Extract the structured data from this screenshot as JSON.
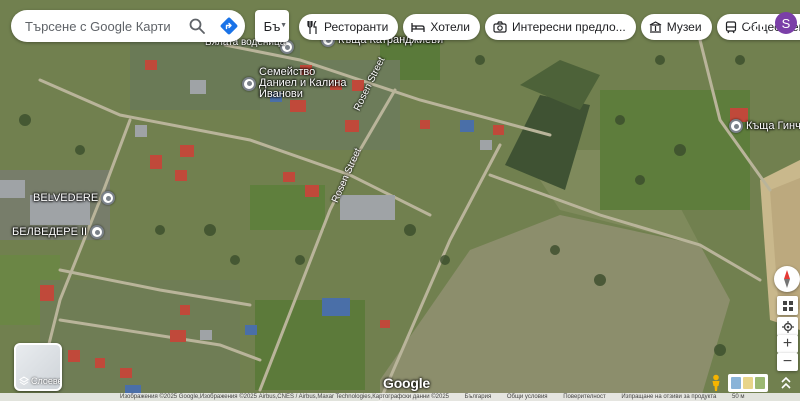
{
  "search": {
    "placeholder": "Търсене с Google Карти"
  },
  "lang_label": "Бъ",
  "chips": [
    "Ресторанти",
    "Хотели",
    "Интересни предло...",
    "Музеи",
    "Обществен"
  ],
  "user_initial": "S",
  "places": [
    {
      "name": "Бялата воденица"
    },
    {
      "name": "Къща Катранджиеви"
    },
    {
      "name": "Семейство Даниел и Калина Иванови"
    },
    {
      "name": "Къща Гинчев"
    },
    {
      "name": "BELVEDERE"
    },
    {
      "name": "БЕЛВЕДЕРЕ II"
    }
  ],
  "streets": [
    "Rosen Street",
    "Rosen Street"
  ],
  "layers_label": "Слоеве",
  "logo": "Google",
  "attribution": [
    "Изображения ©2025 Google,Изображения ©2025 Airbus,CNES / Airbus,Maxar Technologies,Картографски данни ©2025",
    "България",
    "Общи условия",
    "Поверителност",
    "Изпращане на отзиви за продукта",
    "50 м"
  ],
  "colors": {
    "pin_gray": "#7a8189",
    "accent_blue": "#1a73e8",
    "avatar": "#7b3fa8"
  }
}
